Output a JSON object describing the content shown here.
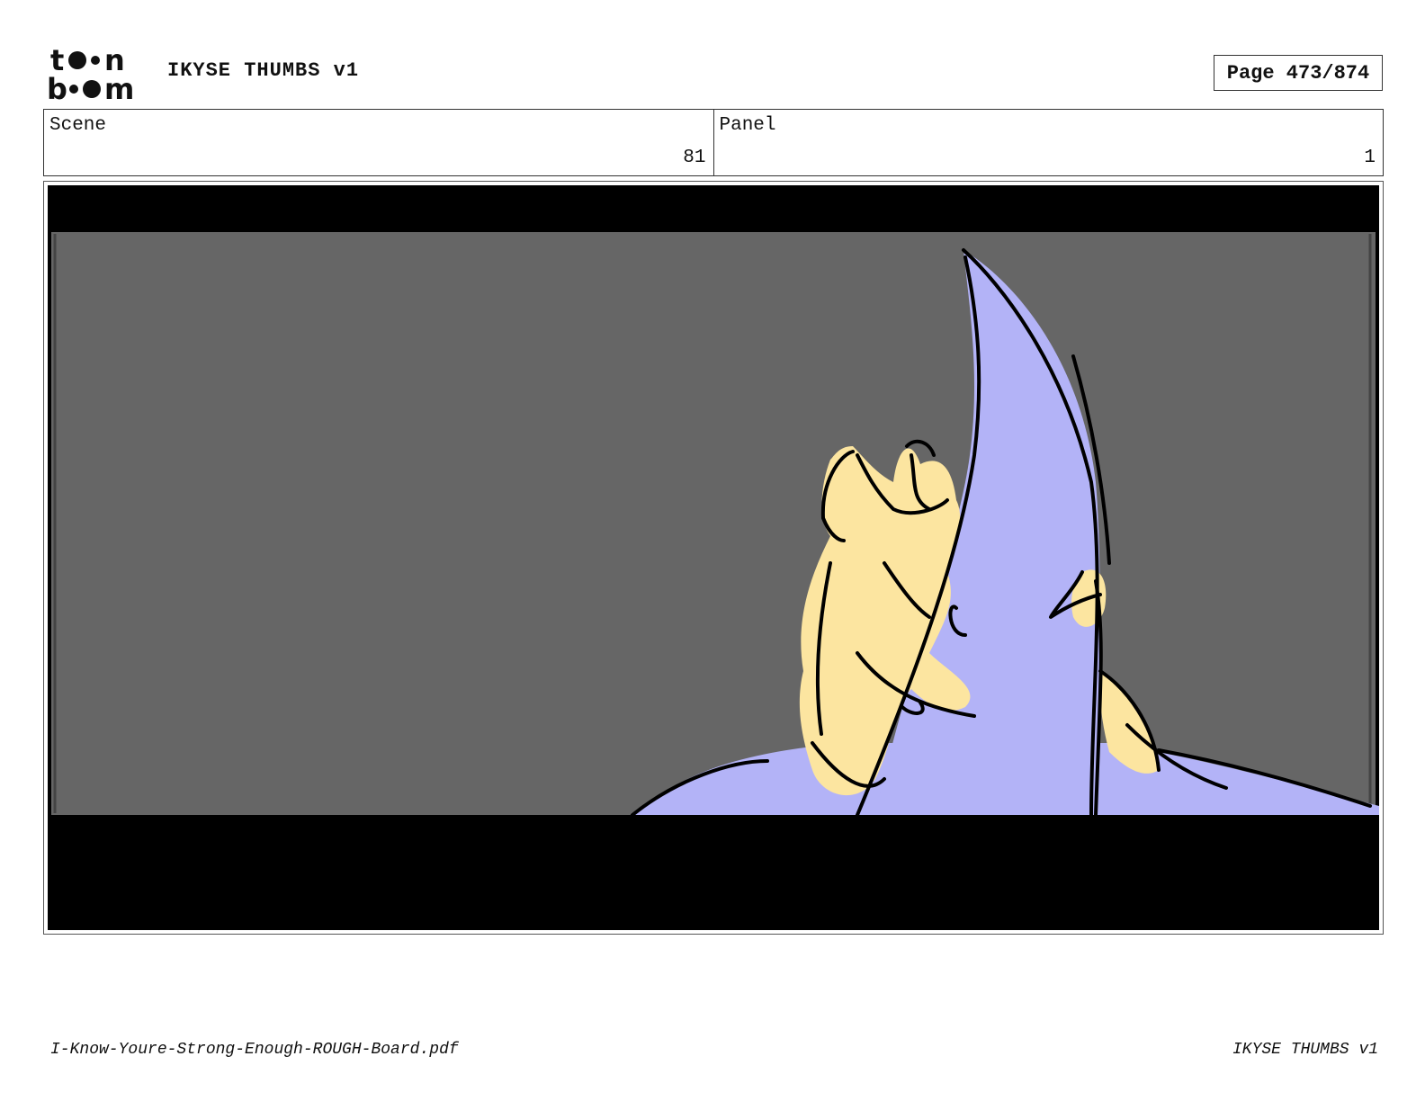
{
  "header": {
    "logo_text_top": "to•n",
    "logo_text_bottom": "b••m",
    "project_title": "IKYSE THUMBS v1",
    "page_label": "Page 473/874"
  },
  "info": {
    "scene_label": "Scene",
    "scene_value": "81",
    "panel_label": "Panel",
    "panel_value": "1"
  },
  "panel": {
    "letterbox_color": "#000000",
    "background_color": "#666666",
    "cloak_color": "#b3b3f7",
    "skin_color": "#fce5a0"
  },
  "footer": {
    "filename": "I-Know-Youre-Strong-Enough-ROUGH-Board.pdf",
    "title": "IKYSE THUMBS v1"
  }
}
